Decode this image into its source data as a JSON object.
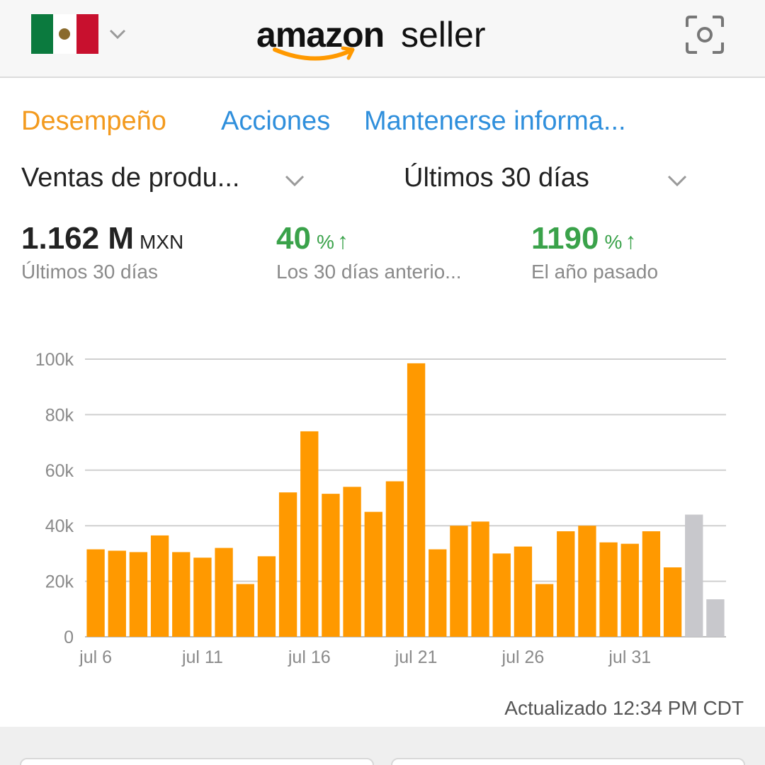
{
  "header": {
    "country_flag": "mexico-flag",
    "logo_primary": "amazon",
    "logo_secondary": "seller",
    "scan_icon": "scan-icon"
  },
  "tabs": [
    {
      "label": "Desempeño",
      "active": true
    },
    {
      "label": "Acciones",
      "active": false
    },
    {
      "label": "Mantenerse informa...",
      "active": false
    }
  ],
  "filters": {
    "metric_select": "Ventas de produ...",
    "period_select": "Últimos 30 días"
  },
  "metrics": [
    {
      "value": "1.162 M",
      "unit": "MXN",
      "label": "Últimos 30 días"
    },
    {
      "value": "40",
      "unit": "%",
      "label": "Los 30 días anterio...",
      "trend": "up"
    },
    {
      "value": "1190",
      "unit": "%",
      "label": "El año pasado",
      "trend": "up"
    }
  ],
  "colors": {
    "accent_orange": "#f39a1e",
    "link_blue": "#2f8fdc",
    "positive_green": "#3aa24a",
    "bar_orange": "#ff9900",
    "bar_gray": "#c8c8cc"
  },
  "chart_data": {
    "type": "bar",
    "y_ticks": [
      "0",
      "20k",
      "40k",
      "60k",
      "80k",
      "100k"
    ],
    "x_tick_labels": [
      "jul 6",
      "jul 11",
      "jul 16",
      "jul 21",
      "jul 26",
      "jul 31"
    ],
    "ylim": [
      0,
      100000
    ],
    "grid": true,
    "values": [
      31500,
      31000,
      30500,
      36500,
      30500,
      28500,
      32000,
      19000,
      29000,
      52000,
      74000,
      51500,
      54000,
      45000,
      56000,
      98500,
      31500,
      40000,
      41500,
      30000,
      32500,
      19000,
      38000,
      40000,
      34000,
      33500,
      38000,
      25000,
      44000,
      13500
    ],
    "bar_status": [
      "final",
      "final",
      "final",
      "final",
      "final",
      "final",
      "final",
      "final",
      "final",
      "final",
      "final",
      "final",
      "final",
      "final",
      "final",
      "final",
      "final",
      "final",
      "final",
      "final",
      "final",
      "final",
      "final",
      "final",
      "final",
      "final",
      "final",
      "final",
      "pending",
      "pending"
    ]
  },
  "footer": {
    "updated_text": "Actualizado 12:34 PM CDT"
  }
}
